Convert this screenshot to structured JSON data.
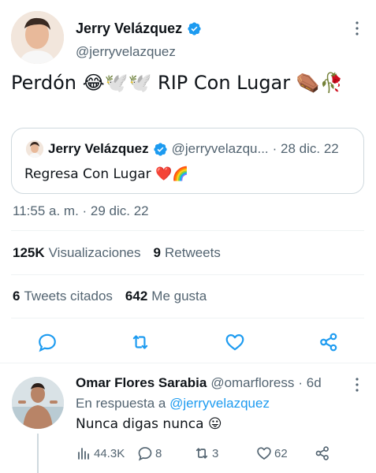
{
  "tweet": {
    "author_name": "Jerry Velázquez",
    "author_handle": "@jerryvelazquez",
    "text": "Perdón 😂🕊️🕊️ RIP Con Lugar ⚰️🥀",
    "timestamp": "11:55 a. m. · 29 dic. 22"
  },
  "quote": {
    "author_name": "Jerry Velázquez",
    "author_handle": "@jerryvelazqu...",
    "date": "· 28 dic. 22",
    "text": "Regresa Con Lugar ❤️🌈"
  },
  "stats": {
    "views_count": "125K",
    "views_label": "Visualizaciones",
    "retweets_count": "9",
    "retweets_label": "Retweets",
    "quotes_count": "6",
    "quotes_label": "Tweets citados",
    "likes_count": "642",
    "likes_label": "Me gusta"
  },
  "actions": [
    "reply-icon",
    "retweet-icon",
    "like-icon",
    "share-icon"
  ],
  "reply": {
    "author_name": "Omar Flores Sarabia",
    "author_handle": "@omarfloress",
    "time": "· 6d",
    "reply_to_prefix": "En respuesta a",
    "reply_to_handle": "@jerryvelazquez",
    "text": "Nunca digas nunca 😛",
    "views": "44.3K",
    "replies": "8",
    "retweets": "3",
    "likes": "62"
  },
  "colors": {
    "accent": "#1d9bf0",
    "text": "#0f1419",
    "secondary": "#536471",
    "border": "#cfd9de"
  }
}
